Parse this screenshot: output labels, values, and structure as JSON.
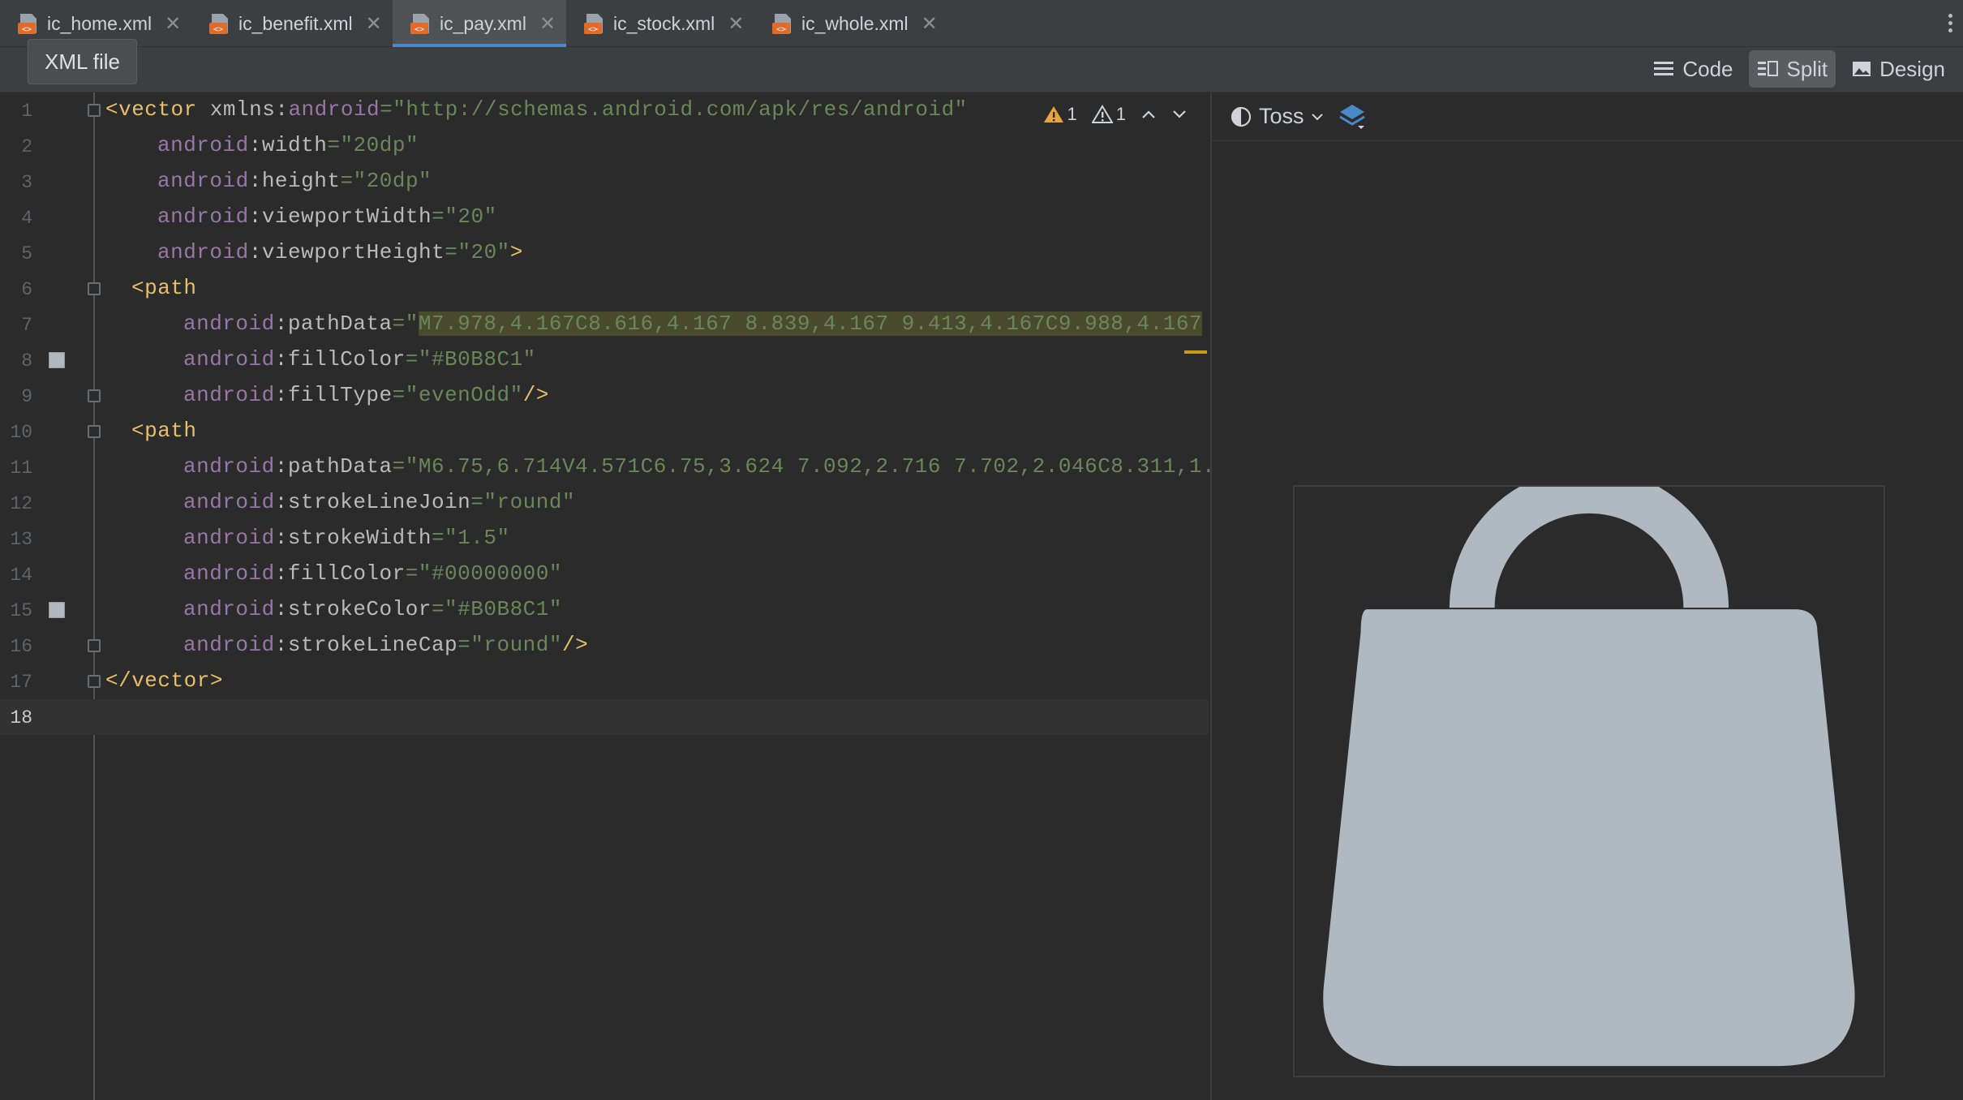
{
  "tabs": [
    {
      "label": "ic_home.xml",
      "active": false
    },
    {
      "label": "ic_benefit.xml",
      "active": false
    },
    {
      "label": "ic_pay.xml",
      "active": true
    },
    {
      "label": "ic_stock.xml",
      "active": false
    },
    {
      "label": "ic_whole.xml",
      "active": false
    }
  ],
  "tooltip": "XML file",
  "view_modes": {
    "code": "Code",
    "split": "Split",
    "design": "Design",
    "active": "Split"
  },
  "inspections": {
    "warnings": "1",
    "weak_warnings": "1"
  },
  "preview": {
    "theme": "Toss",
    "icon_color": "#B0B8C1"
  },
  "code_lines": [
    {
      "n": "1"
    },
    {
      "n": "2"
    },
    {
      "n": "3"
    },
    {
      "n": "4"
    },
    {
      "n": "5"
    },
    {
      "n": "6"
    },
    {
      "n": "7"
    },
    {
      "n": "8"
    },
    {
      "n": "9"
    },
    {
      "n": "10"
    },
    {
      "n": "11"
    },
    {
      "n": "12"
    },
    {
      "n": "13"
    },
    {
      "n": "14"
    },
    {
      "n": "15"
    },
    {
      "n": "16"
    },
    {
      "n": "17"
    },
    {
      "n": "18"
    }
  ],
  "code": {
    "l1_open": "<vector",
    "l1_attr": " xmlns:",
    "l1_ns": "android",
    "l1_val": "=\"http://schemas.android.com/apk/res/android\"",
    "l2_ns": "android",
    "l2_attr": ":width",
    "l2_val": "=\"20dp\"",
    "l3_ns": "android",
    "l3_attr": ":height",
    "l3_val": "=\"20dp\"",
    "l4_ns": "android",
    "l4_attr": ":viewportWidth",
    "l4_val": "=\"20\"",
    "l5_ns": "android",
    "l5_attr": ":viewportHeight",
    "l5_val": "=\"20\"",
    "l5_close": ">",
    "l6": "<path",
    "l7_ns": "android",
    "l7_attr": ":pathData",
    "l7_q": "=\"",
    "l7_val": "M7.978,4.167C8.616,4.167 8.839,4.167 9.413,4.167C9.988,4.167",
    "l8_ns": "android",
    "l8_attr": ":fillColor",
    "l8_val": "=\"#B0B8C1\"",
    "l9_ns": "android",
    "l9_attr": ":fillType",
    "l9_val": "=\"evenOdd\"",
    "l9_close": "/>",
    "l10": "<path",
    "l11_ns": "android",
    "l11_attr": ":pathData",
    "l11_val": "=\"M6.75,6.714V4.571C6.75,3.624 7.092,2.716 7.702,2.046C8.311,1.",
    "l12_ns": "android",
    "l12_attr": ":strokeLineJoin",
    "l12_val": "=\"round\"",
    "l13_ns": "android",
    "l13_attr": ":strokeWidth",
    "l13_val": "=\"1.5\"",
    "l14_ns": "android",
    "l14_attr": ":fillColor",
    "l14_val": "=\"#00000000\"",
    "l15_ns": "android",
    "l15_attr": ":strokeColor",
    "l15_val": "=\"#B0B8C1\"",
    "l16_ns": "android",
    "l16_attr": ":strokeLineCap",
    "l16_val": "=\"round\"",
    "l16_close": "/>",
    "l17": "</vector>"
  }
}
